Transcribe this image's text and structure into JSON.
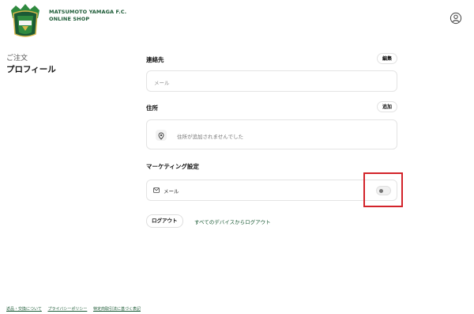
{
  "header": {
    "brand_line1": "MATSUMOTO YAMAGA F.C.",
    "brand_line2": "ONLINE SHOP",
    "logo_icon": "crest-icon",
    "account_icon": "user-circle-icon"
  },
  "sidebar": {
    "orders": "ご注文",
    "profile": "プロフィール"
  },
  "contact": {
    "label": "連絡先",
    "edit_button": "編集",
    "email_placeholder": "メール"
  },
  "address": {
    "label": "住所",
    "add_button": "追加",
    "empty_text": "住所が追加されませんでした"
  },
  "marketing": {
    "label": "マーケティング設定",
    "email_label": "メール",
    "email_enabled": false
  },
  "actions": {
    "logout": "ログアウト",
    "logout_all": "すべてのデバイスからログアウト"
  },
  "footer": {
    "links": [
      "返品・交換について",
      "プライバシーポリシー",
      "特定商取引法に基づく表記"
    ]
  },
  "colors": {
    "brand_green": "#1b5a35",
    "highlight_red": "#d3232a"
  }
}
